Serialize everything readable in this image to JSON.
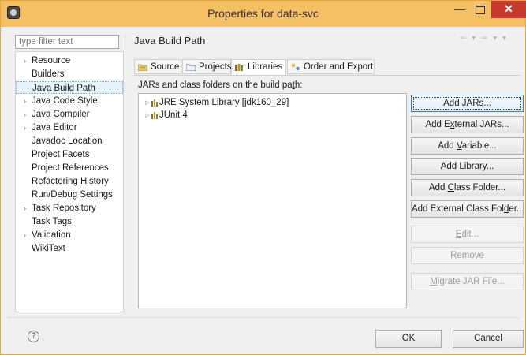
{
  "window": {
    "title": "Properties for data-svc",
    "minimize": "—",
    "close": "✕",
    "accent": "#f5bf63"
  },
  "filter": {
    "placeholder": "type filter text"
  },
  "nav": {
    "items": [
      {
        "label": "Resource",
        "expandable": true
      },
      {
        "label": "Builders",
        "expandable": false
      },
      {
        "label": "Java Build Path",
        "expandable": false,
        "selected": true
      },
      {
        "label": "Java Code Style",
        "expandable": true
      },
      {
        "label": "Java Compiler",
        "expandable": true
      },
      {
        "label": "Java Editor",
        "expandable": true
      },
      {
        "label": "Javadoc Location",
        "expandable": false
      },
      {
        "label": "Project Facets",
        "expandable": false
      },
      {
        "label": "Project References",
        "expandable": false
      },
      {
        "label": "Refactoring History",
        "expandable": false
      },
      {
        "label": "Run/Debug Settings",
        "expandable": false
      },
      {
        "label": "Task Repository",
        "expandable": true
      },
      {
        "label": "Task Tags",
        "expandable": false
      },
      {
        "label": "Validation",
        "expandable": true
      },
      {
        "label": "WikiText",
        "expandable": false
      }
    ]
  },
  "page": {
    "title": "Java Build Path",
    "history_controls": "⇦ ▾ ⇨ ▾ ▾",
    "tabs": [
      {
        "label": "Source",
        "icon": "source-folder-icon"
      },
      {
        "label": "Projects",
        "icon": "projects-icon"
      },
      {
        "label": "Libraries",
        "icon": "libraries-icon",
        "active": true
      },
      {
        "label": "Order and Export",
        "icon": "order-export-icon"
      }
    ],
    "caption_pre": "JARs and class folders on the build pa",
    "caption_mn": "t",
    "caption_post": "h:",
    "tree": [
      {
        "label": "JRE System Library [jdk160_29]"
      },
      {
        "label": "JUnit 4"
      }
    ]
  },
  "buttons": {
    "add_jars": {
      "pre": "Add ",
      "mn": "J",
      "post": "ARs..."
    },
    "add_external_jars": {
      "pre": "Add E",
      "mn": "x",
      "post": "ternal JARs..."
    },
    "add_variable": {
      "pre": "Add ",
      "mn": "V",
      "post": "ariable..."
    },
    "add_library": {
      "pre": "Add Libr",
      "mn": "a",
      "post": "ry..."
    },
    "add_class_folder": {
      "pre": "Add ",
      "mn": "C",
      "post": "lass Folder..."
    },
    "add_external_class_folder": {
      "pre": "Add External Class Fol",
      "mn": "d",
      "post": "er..."
    },
    "edit": {
      "pre": "",
      "mn": "E",
      "post": "dit..."
    },
    "remove": {
      "pre": "Remove",
      "mn": "",
      "post": ""
    },
    "migrate": {
      "pre": "",
      "mn": "M",
      "post": "igrate JAR File..."
    }
  },
  "footer": {
    "help": "?",
    "ok": "OK",
    "cancel": "Cancel"
  }
}
